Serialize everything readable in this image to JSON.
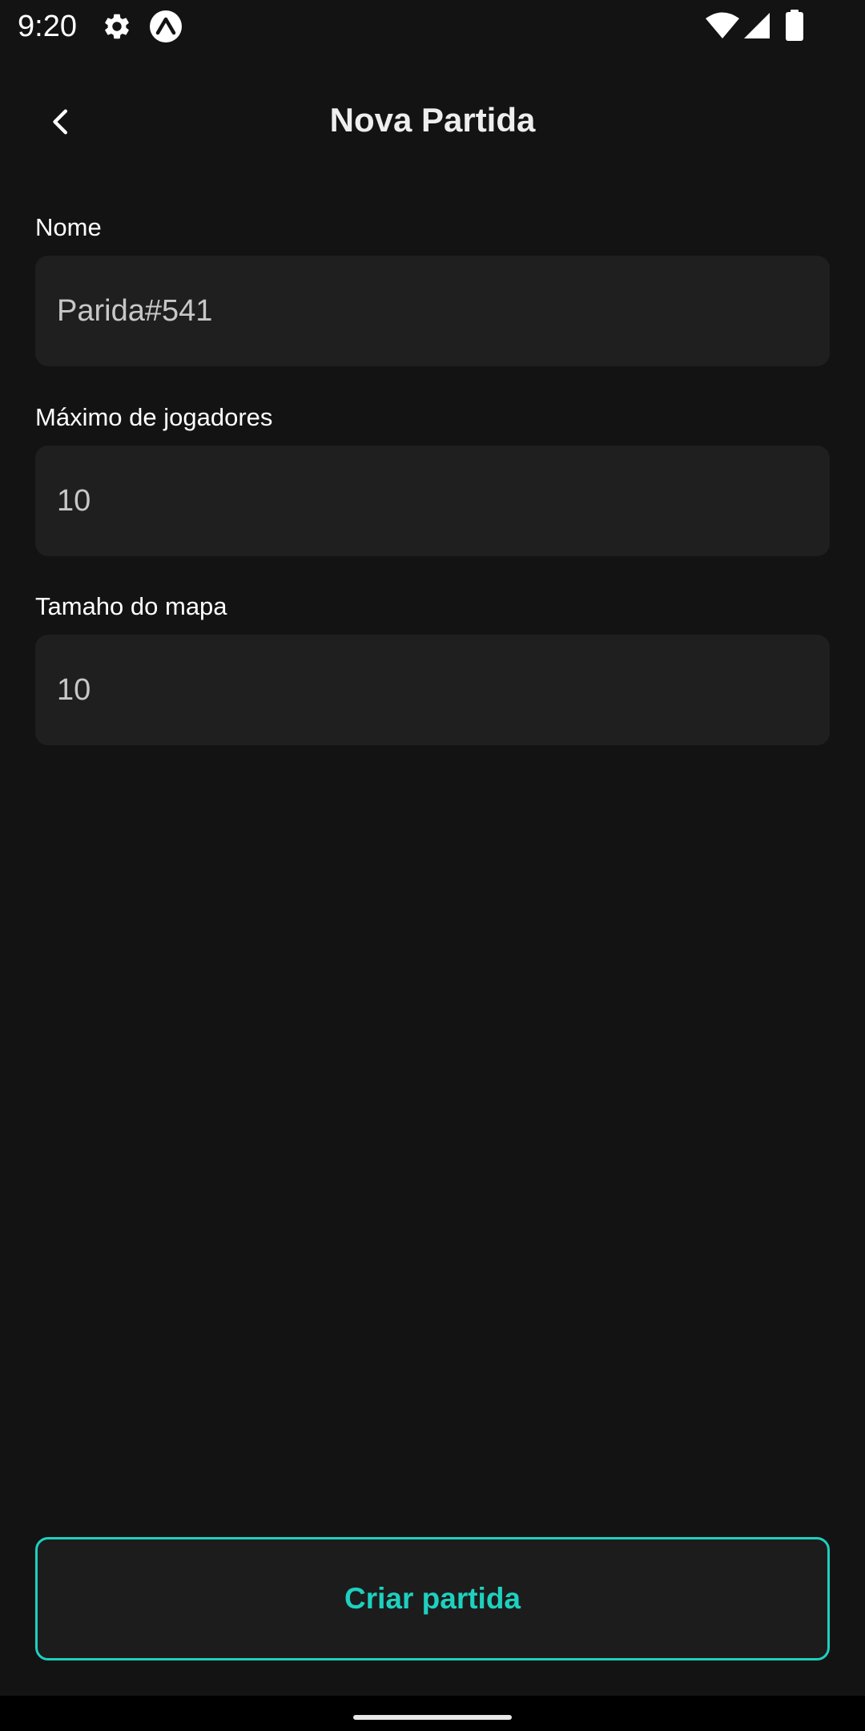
{
  "status_bar": {
    "time": "9:20",
    "icons": [
      "gear-icon",
      "expo-icon",
      "wifi-icon",
      "signal-icon",
      "battery-icon"
    ]
  },
  "header": {
    "title": "Nova Partida",
    "back_icon": "chevron-left-icon"
  },
  "form": {
    "fields": [
      {
        "label": "Nome",
        "value": "Parida#541"
      },
      {
        "label": "Máximo de jogadores",
        "value": "10"
      },
      {
        "label": "Tamaho do mapa",
        "value": "10"
      }
    ]
  },
  "actions": {
    "create_label": "Criar partida"
  },
  "colors": {
    "background": "#131313",
    "input_background": "#1f1f1f",
    "accent": "#1ed0bf",
    "text": "#ffffff",
    "input_text": "#c7c7c7"
  }
}
